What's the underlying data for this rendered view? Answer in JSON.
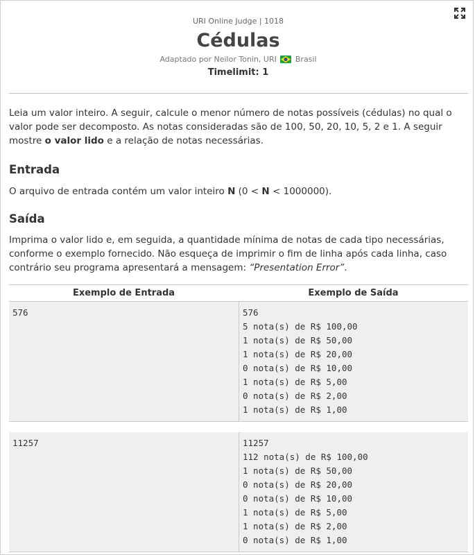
{
  "header": {
    "judge": "URI Online Judge | 1018",
    "title": "Cédulas",
    "author_prefix": "Adaptado por Neilor Tonin, URI",
    "author_country": "Brasil",
    "timelimit": "Timelimit: 1"
  },
  "description": {
    "part1": "Leia um valor inteiro. A seguir, calcule o menor número de notas possíveis (cédulas) no qual o valor pode ser decomposto. As notas consideradas são de 100, 50, 20, 10, 5, 2 e 1. A seguir mostre ",
    "bold": "o valor lido",
    "part2": " e a relação de notas necessárias."
  },
  "entrada": {
    "heading": "Entrada",
    "text1": "O arquivo de entrada contém um valor inteiro ",
    "n1": "N",
    "text2": " (0 < ",
    "n2": "N",
    "text3": " < 1000000)."
  },
  "saida": {
    "heading": "Saída",
    "text": "Imprima o valor lido e, em seguida, a quantidade mínima de notas de cada tipo necessárias, conforme o exemplo fornecido. Não esqueça de imprimir o fim de linha após cada linha, caso contrário seu programa apresentará a mensagem: ",
    "italic": "“Presentation Error”",
    "end": "."
  },
  "examples": {
    "input_header": "Exemplo de Entrada",
    "output_header": "Exemplo de Saída",
    "rows": [
      {
        "input": [
          "576"
        ],
        "output": [
          "576",
          "5 nota(s) de R$ 100,00",
          "1 nota(s) de R$ 50,00",
          "1 nota(s) de R$ 20,00",
          "0 nota(s) de R$ 10,00",
          "1 nota(s) de R$ 5,00",
          "0 nota(s) de R$ 2,00",
          "1 nota(s) de R$ 1,00"
        ]
      },
      {
        "input": [
          "11257"
        ],
        "output": [
          "11257",
          "112 nota(s) de R$ 100,00",
          "1 nota(s) de R$ 50,00",
          "0 nota(s) de R$ 20,00",
          "0 nota(s) de R$ 10,00",
          "1 nota(s) de R$ 5,00",
          "1 nota(s) de R$ 2,00",
          "0 nota(s) de R$ 1,00"
        ]
      }
    ]
  },
  "icons": {
    "expand": "expand-icon",
    "flag": "brazil-flag-icon"
  }
}
